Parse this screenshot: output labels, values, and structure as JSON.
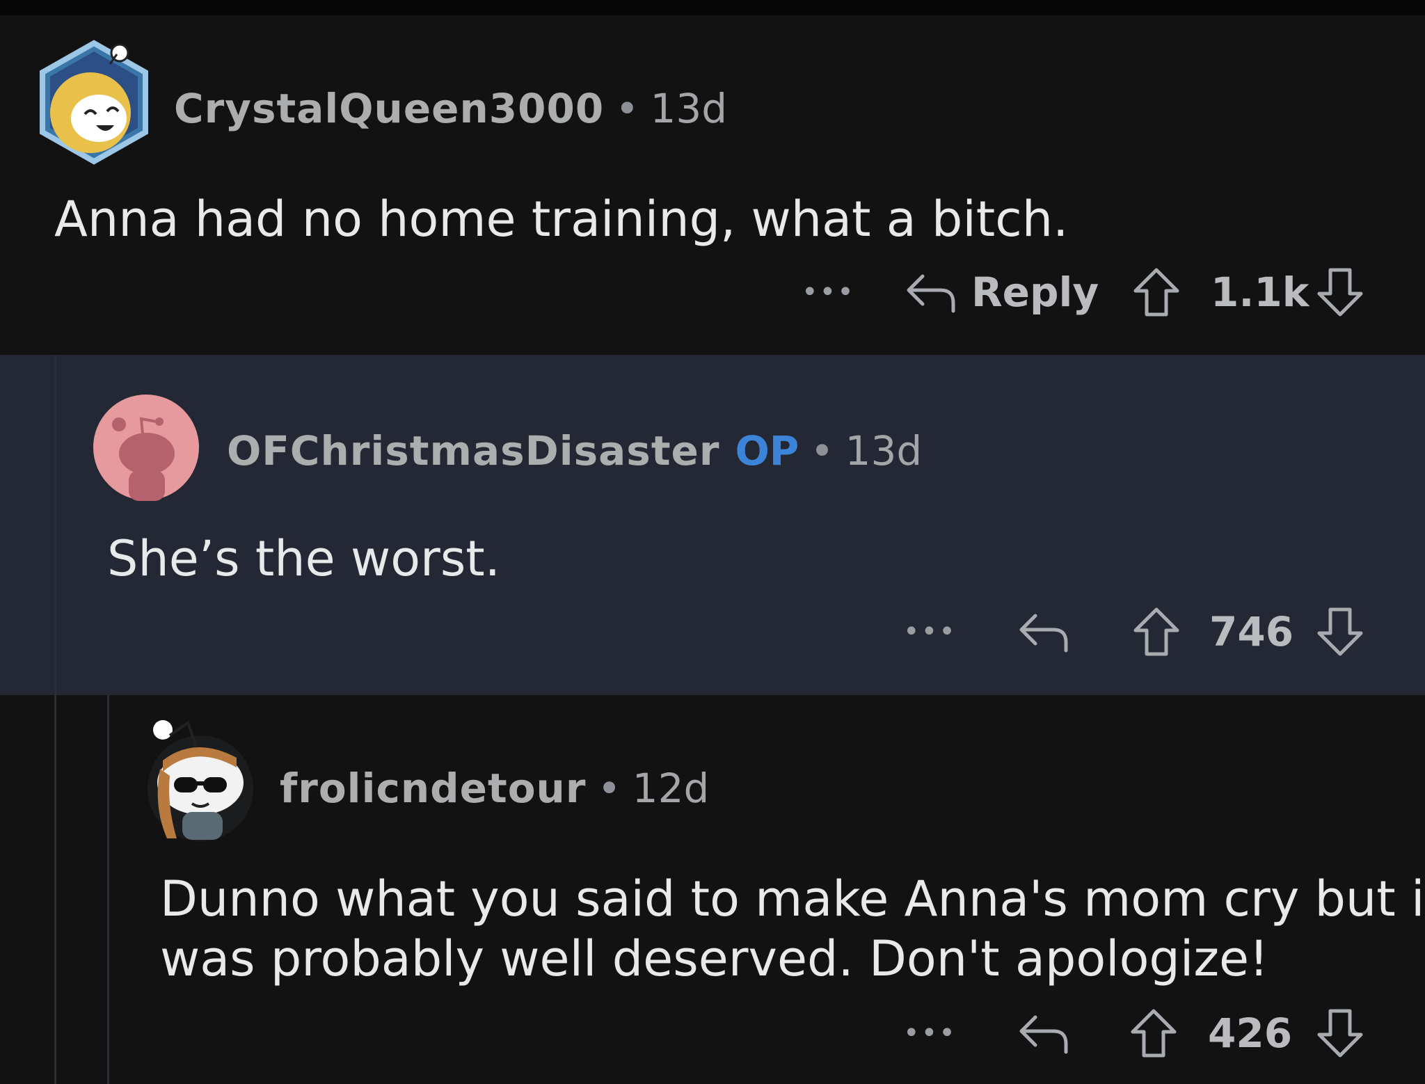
{
  "comments": [
    {
      "username": "CrystalQueen3000",
      "age": "13d",
      "text": "Anna had no home training, what a bitch.",
      "actions": {
        "more": "•••",
        "reply_label": "Reply",
        "score": "1.1k"
      }
    },
    {
      "username": "OFChristmasDisaster",
      "badge": "OP",
      "age": "13d",
      "text": "She’s the worst.",
      "actions": {
        "more": "•••",
        "score": "746"
      }
    },
    {
      "username": "frolicndetour",
      "age": "12d",
      "text_lines": [
        "Dunno what you said to make Anna's mom cry but it",
        "was probably well deserved.  Don't apologize!"
      ],
      "actions": {
        "more": "•••",
        "score": "426"
      }
    }
  ],
  "separator": "•",
  "colors": {
    "op_badge": "#3b84d8",
    "reply_highlight": "#232834",
    "background": "#111112"
  }
}
